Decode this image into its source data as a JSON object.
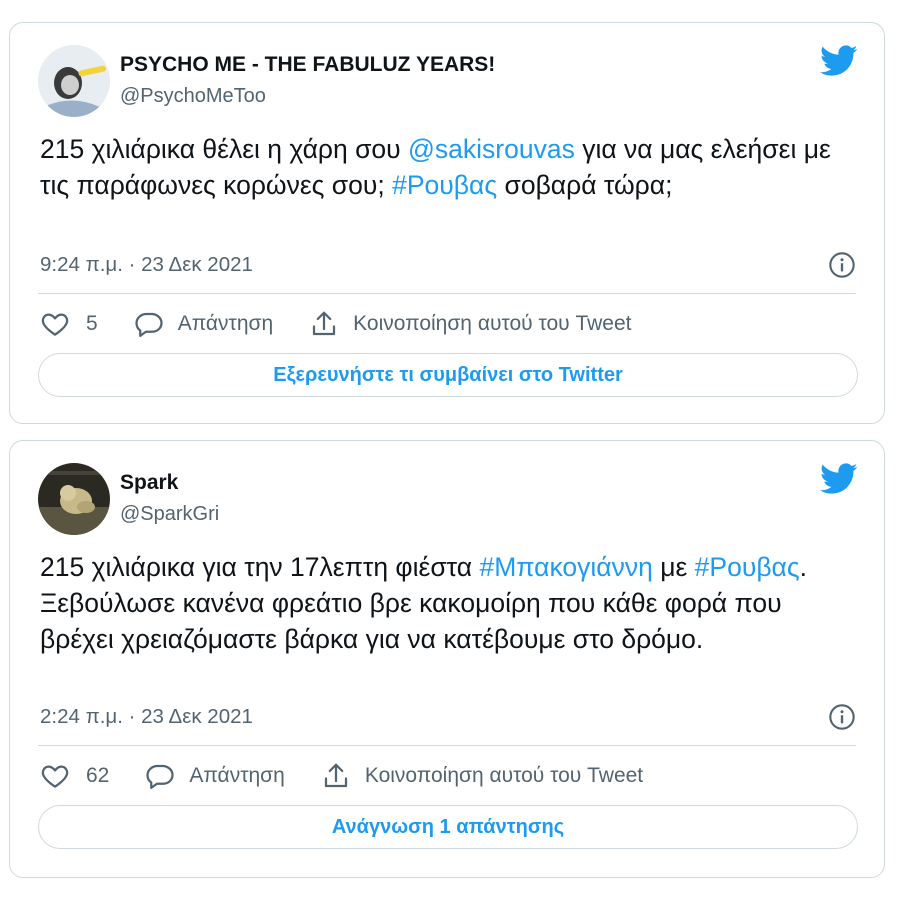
{
  "tweets": [
    {
      "name": "PSYCHO ME - THE FABULUZ YEARS!",
      "handle": "@PsychoMeToo",
      "text": [
        {
          "t": "215 χιλιάρικα θέλει η χάρη σου ",
          "link": false
        },
        {
          "t": "@sakisrouvas",
          "link": true
        },
        {
          "t": " για να μας ελεήσει με τις παράφωνες κορώνες σου; ",
          "link": false
        },
        {
          "t": "#Ρουβας",
          "link": true
        },
        {
          "t": " σοβαρά τώρα;",
          "link": false
        }
      ],
      "timestamp": "9:24 π.μ. · 23 Δεκ 2021",
      "likes": "5",
      "reply_label": "Απάντηση",
      "share_label": "Κοινοποίηση αυτού του Tweet",
      "button_label": "Εξερευνήστε τι συμβαίνει στο Twitter"
    },
    {
      "name": "Spark",
      "handle": "@SparkGri",
      "text": [
        {
          "t": "215 χιλιάρικα για την 17λεπτη φιέστα ",
          "link": false
        },
        {
          "t": "#Μπακογιάννη",
          "link": true
        },
        {
          "t": " με ",
          "link": false
        },
        {
          "t": "#Ρουβας",
          "link": true
        },
        {
          "t": ". Ξεβούλωσε κανένα φρεάτιο βρε κακομοίρη που κάθε φορά που βρέχει χρειαζόμαστε βάρκα για να κατέβουμε στο δρόμο.",
          "link": false
        }
      ],
      "timestamp": "2:24 π.μ. · 23 Δεκ 2021",
      "likes": "62",
      "reply_label": "Απάντηση",
      "share_label": "Κοινοποίηση αυτού του Tweet",
      "button_label": "Ανάγνωση 1 απάντησης"
    }
  ],
  "colors": {
    "accent": "#1d9bf0",
    "text": "#0f1419",
    "muted": "#536471",
    "border": "#cfd9de"
  },
  "icons": [
    "twitter-bird-icon",
    "info-icon",
    "heart-icon",
    "reply-icon",
    "share-icon"
  ]
}
